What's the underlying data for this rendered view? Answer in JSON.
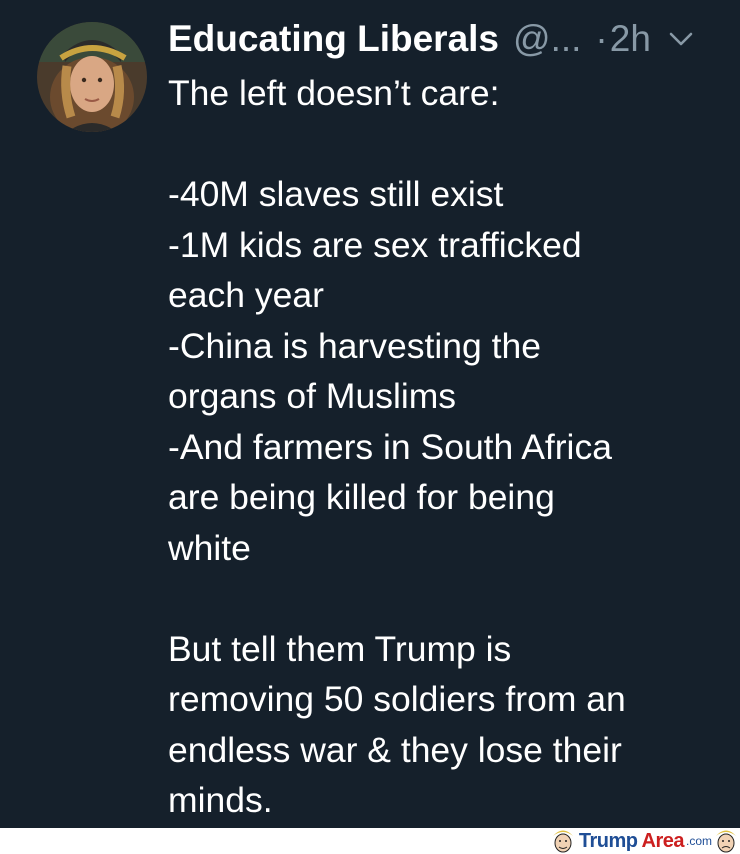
{
  "tweet": {
    "author_name": "Educating Liberals",
    "handle": "@...",
    "separator": "·",
    "timestamp": "2h",
    "lines": [
      "The left doesn’t care:",
      "",
      "-40M slaves still exist",
      "-1M kids are sex trafficked",
      "each year",
      "-China is harvesting the",
      "organs of Muslims",
      "-And farmers in South Africa",
      "are being killed for being",
      "white",
      "",
      "But tell them Trump is",
      "removing 50 soldiers from an",
      "endless war & they lose their",
      "minds."
    ]
  },
  "watermark": {
    "part1": "Trump",
    "part2": "Area",
    "suffix": ".com"
  },
  "colors": {
    "background": "#15202b",
    "text": "#ffffff",
    "muted": "#8899a6"
  },
  "icons": {
    "menu": "chevron-down-icon",
    "avatar": "user-avatar"
  }
}
